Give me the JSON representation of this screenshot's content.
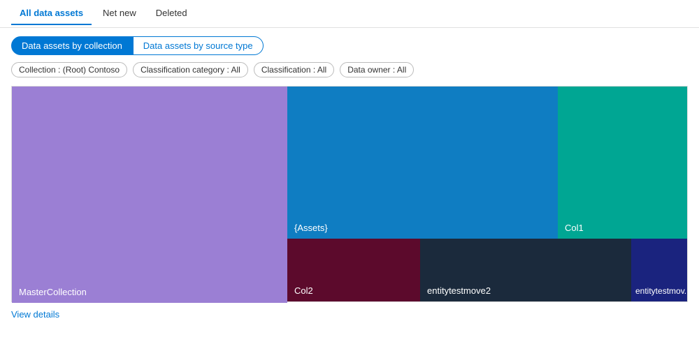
{
  "tabs": [
    {
      "id": "all",
      "label": "All data assets",
      "active": true
    },
    {
      "id": "netnew",
      "label": "Net new",
      "active": false
    },
    {
      "id": "deleted",
      "label": "Deleted",
      "active": false
    }
  ],
  "viewToggle": {
    "byCollection": {
      "label": "Data assets by collection",
      "active": true
    },
    "bySourceType": {
      "label": "Data assets by source type",
      "active": false
    }
  },
  "filters": [
    {
      "id": "collection",
      "label": "Collection : (Root) Contoso"
    },
    {
      "id": "classcat",
      "label": "Classification category : All"
    },
    {
      "id": "classification",
      "label": "Classification : All"
    },
    {
      "id": "dataowner",
      "label": "Data owner : All"
    }
  ],
  "tiles": {
    "master": {
      "label": "MasterCollection"
    },
    "assets": {
      "label": "{Assets}"
    },
    "col1": {
      "label": "Col1"
    },
    "col2": {
      "label": "Col2"
    },
    "entity2": {
      "label": "entitytestmove2"
    },
    "entitymov": {
      "label": "entitytestmov..."
    }
  },
  "viewDetails": {
    "label": "View details"
  }
}
